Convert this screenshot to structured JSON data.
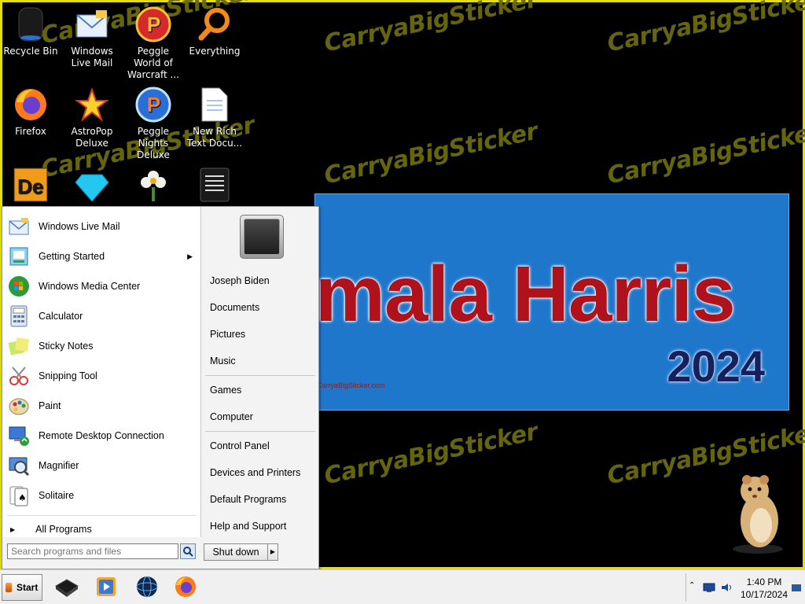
{
  "desktop": {
    "watermark_text": "CarryaBigSticker",
    "icons": [
      {
        "label": "Recycle Bin"
      },
      {
        "label": "Windows Live Mail"
      },
      {
        "label": "Peggle World of Warcraft ..."
      },
      {
        "label": "Everything"
      },
      {
        "label": "Firefox"
      },
      {
        "label": "AstroPop Deluxe"
      },
      {
        "label": "Peggle Nights Deluxe"
      },
      {
        "label": "New Rich Text Docu..."
      }
    ],
    "banner": {
      "name_text": "mala Harris",
      "year_text": "2024",
      "url_text": "CarryaBigSticker.com"
    }
  },
  "start_menu": {
    "programs": [
      {
        "label": "Windows Live Mail",
        "icon": "mail-icon"
      },
      {
        "label": "Getting Started",
        "icon": "getting-started-icon",
        "has_submenu": true
      },
      {
        "label": "Windows Media Center",
        "icon": "media-center-icon"
      },
      {
        "label": "Calculator",
        "icon": "calculator-icon"
      },
      {
        "label": "Sticky Notes",
        "icon": "sticky-notes-icon"
      },
      {
        "label": "Snipping Tool",
        "icon": "scissors-icon"
      },
      {
        "label": "Paint",
        "icon": "paint-palette-icon"
      },
      {
        "label": "Remote Desktop Connection",
        "icon": "remote-desktop-icon"
      },
      {
        "label": "Magnifier",
        "icon": "magnifier-icon"
      },
      {
        "label": "Solitaire",
        "icon": "cards-icon"
      }
    ],
    "all_programs_label": "All Programs",
    "search_placeholder": "Search programs and files",
    "right_links": {
      "user": "Joseph Biden",
      "documents": "Documents",
      "pictures": "Pictures",
      "music": "Music",
      "games": "Games",
      "computer": "Computer",
      "control_panel": "Control Panel",
      "devices_printers": "Devices and Printers",
      "default_programs": "Default Programs",
      "help_support": "Help and Support"
    },
    "shutdown_label": "Shut down"
  },
  "taskbar": {
    "start_label": "Start",
    "pinned": [
      "Notebook app",
      "Media player",
      "Globe app",
      "Firefox"
    ],
    "clock": {
      "time": "1:40 PM",
      "date": "10/17/2024"
    }
  },
  "colors": {
    "desktop_border": "#e6e000",
    "banner_bg": "#1f77cc",
    "banner_name": "#b0121c",
    "banner_year": "#16205e"
  }
}
